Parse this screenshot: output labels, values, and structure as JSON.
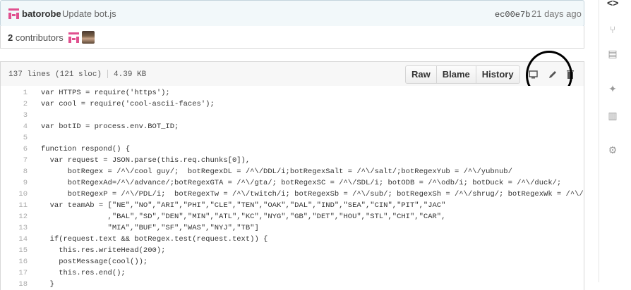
{
  "commit": {
    "author": "batorobe",
    "message": "Update bot.js",
    "sha": "ec00e7b",
    "age": "21 days ago"
  },
  "contributors": {
    "count": "2",
    "label": "contributors"
  },
  "file": {
    "lines": "137 lines (121 sloc)",
    "size": "4.39 KB",
    "buttons": {
      "raw": "Raw",
      "blame": "Blame",
      "history": "History"
    }
  },
  "icons": {
    "desktop": "desktop-icon",
    "edit": "pencil-icon",
    "delete": "trash-icon"
  },
  "code_lines": [
    {
      "n": "1",
      "text": "var HTTPS = require('https');"
    },
    {
      "n": "2",
      "text": "var cool = require('cool-ascii-faces');"
    },
    {
      "n": "3",
      "text": ""
    },
    {
      "n": "4",
      "text": "var botID = process.env.BOT_ID;"
    },
    {
      "n": "5",
      "text": ""
    },
    {
      "n": "6",
      "text": "function respond() {"
    },
    {
      "n": "7",
      "text": "  var request = JSON.parse(this.req.chunks[0]),"
    },
    {
      "n": "8",
      "text": "      botRegex = /^\\/cool guy/;  botRegexDL = /^\\/DDL/i;botRegexSalt = /^\\/salt/;botRegexYub = /^\\/yubnub/"
    },
    {
      "n": "9",
      "text": "      botRegexAd=/^\\/advance/;botRegexGTA = /^\\/gta/; botRegexSC = /^\\/SDL/i; botODB = /^\\odb/i; botDuck = /^\\/duck/;"
    },
    {
      "n": "10",
      "text": "      botRegexP = /^\\/PDL/i;  botRegexTw = /^\\/twitch/i; botRegexSb = /^\\/sub/; botRegexSh = /^\\/shrug/; botRegexWk = /^\\/users/;"
    },
    {
      "n": "11",
      "text": "  var teamAb = [\"NE\",\"NO\",\"ARI\",\"PHI\",\"CLE\",\"TEN\",\"OAK\",\"DAL\",\"IND\",\"SEA\",\"CIN\",\"PIT\",\"JAC\""
    },
    {
      "n": "12",
      "text": "               ,\"BAL\",\"SD\",\"DEN\",\"MIN\",\"ATL\",\"KC\",\"NYG\",\"GB\",\"DET\",\"HOU\",\"STL\",\"CHI\",\"CAR\","
    },
    {
      "n": "13",
      "text": "               \"MIA\",\"BUF\",\"SF\",\"WAS\",\"NYJ\",\"TB\"]"
    },
    {
      "n": "14",
      "text": "  if(request.text && botRegex.test(request.text)) {"
    },
    {
      "n": "15",
      "text": "    this.res.writeHead(200);"
    },
    {
      "n": "16",
      "text": "    postMessage(cool());"
    },
    {
      "n": "17",
      "text": "    this.res.end();"
    },
    {
      "n": "18",
      "text": "  }"
    }
  ],
  "rail": [
    "code-icon",
    "pull-request-icon",
    "book-icon",
    "pulse-icon",
    "graph-icon",
    "gear-icon"
  ]
}
